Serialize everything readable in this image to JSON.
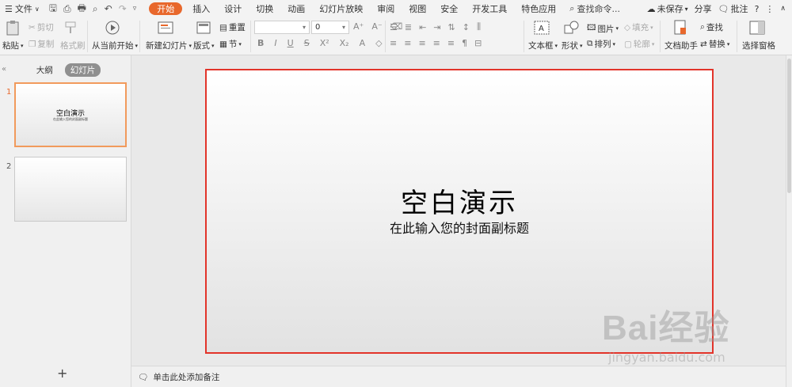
{
  "menu": {
    "file_label": "文件",
    "tabs": [
      "开始",
      "插入",
      "设计",
      "切换",
      "动画",
      "幻灯片放映",
      "审阅",
      "视图",
      "安全",
      "开发工具",
      "特色应用"
    ],
    "active_tab": "开始",
    "search_label": "查找命令...",
    "unsaved_label": "未保存",
    "share_label": "分享",
    "comment_label": "批注",
    "help_label": "?"
  },
  "ribbon": {
    "paste": "粘贴",
    "cut": "剪切",
    "copy": "复制",
    "format_painter": "格式刷",
    "from_current": "从当前开始",
    "new_slide": "新建幻灯片",
    "layout": "版式",
    "reset": "重置",
    "section": "节",
    "font_size": "0",
    "textbox": "文本框",
    "shape": "形状",
    "picture": "图片",
    "fill": "填充",
    "arrange": "排列",
    "outline": "轮廓",
    "doc_assistant": "文档助手",
    "find": "查找",
    "replace": "替换",
    "selection_pane": "选择窗格"
  },
  "left_panel": {
    "outline_tab": "大纲",
    "slides_tab": "幻灯片",
    "slides": [
      {
        "number": "1",
        "title": "空白演示",
        "subtitle": "在此输入您的封面副标题"
      },
      {
        "number": "2",
        "title": "",
        "subtitle": ""
      }
    ],
    "add_slide": "+"
  },
  "slide": {
    "title": "空白演示",
    "subtitle": "在此输入您的封面副标题"
  },
  "notes": {
    "placeholder": "单击此处添加备注"
  },
  "watermark": {
    "logo": "Bai经验",
    "url": "jingyan.baidu.com"
  },
  "colors": {
    "accent": "#e8682c",
    "selection_border": "#e2342a"
  }
}
